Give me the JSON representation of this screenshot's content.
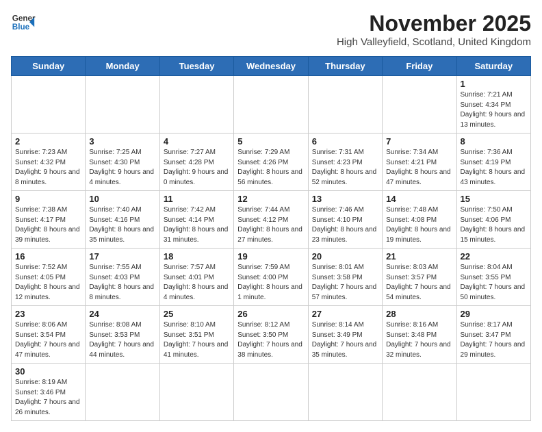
{
  "header": {
    "logo_general": "General",
    "logo_blue": "Blue",
    "month": "November 2025",
    "location": "High Valleyfield, Scotland, United Kingdom"
  },
  "days_of_week": [
    "Sunday",
    "Monday",
    "Tuesday",
    "Wednesday",
    "Thursday",
    "Friday",
    "Saturday"
  ],
  "weeks": [
    [
      {
        "day": "",
        "info": ""
      },
      {
        "day": "",
        "info": ""
      },
      {
        "day": "",
        "info": ""
      },
      {
        "day": "",
        "info": ""
      },
      {
        "day": "",
        "info": ""
      },
      {
        "day": "",
        "info": ""
      },
      {
        "day": "1",
        "info": "Sunrise: 7:21 AM\nSunset: 4:34 PM\nDaylight: 9 hours\nand 13 minutes."
      }
    ],
    [
      {
        "day": "2",
        "info": "Sunrise: 7:23 AM\nSunset: 4:32 PM\nDaylight: 9 hours\nand 8 minutes."
      },
      {
        "day": "3",
        "info": "Sunrise: 7:25 AM\nSunset: 4:30 PM\nDaylight: 9 hours\nand 4 minutes."
      },
      {
        "day": "4",
        "info": "Sunrise: 7:27 AM\nSunset: 4:28 PM\nDaylight: 9 hours\nand 0 minutes."
      },
      {
        "day": "5",
        "info": "Sunrise: 7:29 AM\nSunset: 4:26 PM\nDaylight: 8 hours\nand 56 minutes."
      },
      {
        "day": "6",
        "info": "Sunrise: 7:31 AM\nSunset: 4:23 PM\nDaylight: 8 hours\nand 52 minutes."
      },
      {
        "day": "7",
        "info": "Sunrise: 7:34 AM\nSunset: 4:21 PM\nDaylight: 8 hours\nand 47 minutes."
      },
      {
        "day": "8",
        "info": "Sunrise: 7:36 AM\nSunset: 4:19 PM\nDaylight: 8 hours\nand 43 minutes."
      }
    ],
    [
      {
        "day": "9",
        "info": "Sunrise: 7:38 AM\nSunset: 4:17 PM\nDaylight: 8 hours\nand 39 minutes."
      },
      {
        "day": "10",
        "info": "Sunrise: 7:40 AM\nSunset: 4:16 PM\nDaylight: 8 hours\nand 35 minutes."
      },
      {
        "day": "11",
        "info": "Sunrise: 7:42 AM\nSunset: 4:14 PM\nDaylight: 8 hours\nand 31 minutes."
      },
      {
        "day": "12",
        "info": "Sunrise: 7:44 AM\nSunset: 4:12 PM\nDaylight: 8 hours\nand 27 minutes."
      },
      {
        "day": "13",
        "info": "Sunrise: 7:46 AM\nSunset: 4:10 PM\nDaylight: 8 hours\nand 23 minutes."
      },
      {
        "day": "14",
        "info": "Sunrise: 7:48 AM\nSunset: 4:08 PM\nDaylight: 8 hours\nand 19 minutes."
      },
      {
        "day": "15",
        "info": "Sunrise: 7:50 AM\nSunset: 4:06 PM\nDaylight: 8 hours\nand 15 minutes."
      }
    ],
    [
      {
        "day": "16",
        "info": "Sunrise: 7:52 AM\nSunset: 4:05 PM\nDaylight: 8 hours\nand 12 minutes."
      },
      {
        "day": "17",
        "info": "Sunrise: 7:55 AM\nSunset: 4:03 PM\nDaylight: 8 hours\nand 8 minutes."
      },
      {
        "day": "18",
        "info": "Sunrise: 7:57 AM\nSunset: 4:01 PM\nDaylight: 8 hours\nand 4 minutes."
      },
      {
        "day": "19",
        "info": "Sunrise: 7:59 AM\nSunset: 4:00 PM\nDaylight: 8 hours\nand 1 minute."
      },
      {
        "day": "20",
        "info": "Sunrise: 8:01 AM\nSunset: 3:58 PM\nDaylight: 7 hours\nand 57 minutes."
      },
      {
        "day": "21",
        "info": "Sunrise: 8:03 AM\nSunset: 3:57 PM\nDaylight: 7 hours\nand 54 minutes."
      },
      {
        "day": "22",
        "info": "Sunrise: 8:04 AM\nSunset: 3:55 PM\nDaylight: 7 hours\nand 50 minutes."
      }
    ],
    [
      {
        "day": "23",
        "info": "Sunrise: 8:06 AM\nSunset: 3:54 PM\nDaylight: 7 hours\nand 47 minutes."
      },
      {
        "day": "24",
        "info": "Sunrise: 8:08 AM\nSunset: 3:53 PM\nDaylight: 7 hours\nand 44 minutes."
      },
      {
        "day": "25",
        "info": "Sunrise: 8:10 AM\nSunset: 3:51 PM\nDaylight: 7 hours\nand 41 minutes."
      },
      {
        "day": "26",
        "info": "Sunrise: 8:12 AM\nSunset: 3:50 PM\nDaylight: 7 hours\nand 38 minutes."
      },
      {
        "day": "27",
        "info": "Sunrise: 8:14 AM\nSunset: 3:49 PM\nDaylight: 7 hours\nand 35 minutes."
      },
      {
        "day": "28",
        "info": "Sunrise: 8:16 AM\nSunset: 3:48 PM\nDaylight: 7 hours\nand 32 minutes."
      },
      {
        "day": "29",
        "info": "Sunrise: 8:17 AM\nSunset: 3:47 PM\nDaylight: 7 hours\nand 29 minutes."
      }
    ],
    [
      {
        "day": "30",
        "info": "Sunrise: 8:19 AM\nSunset: 3:46 PM\nDaylight: 7 hours\nand 26 minutes."
      },
      {
        "day": "",
        "info": ""
      },
      {
        "day": "",
        "info": ""
      },
      {
        "day": "",
        "info": ""
      },
      {
        "day": "",
        "info": ""
      },
      {
        "day": "",
        "info": ""
      },
      {
        "day": "",
        "info": ""
      }
    ]
  ]
}
